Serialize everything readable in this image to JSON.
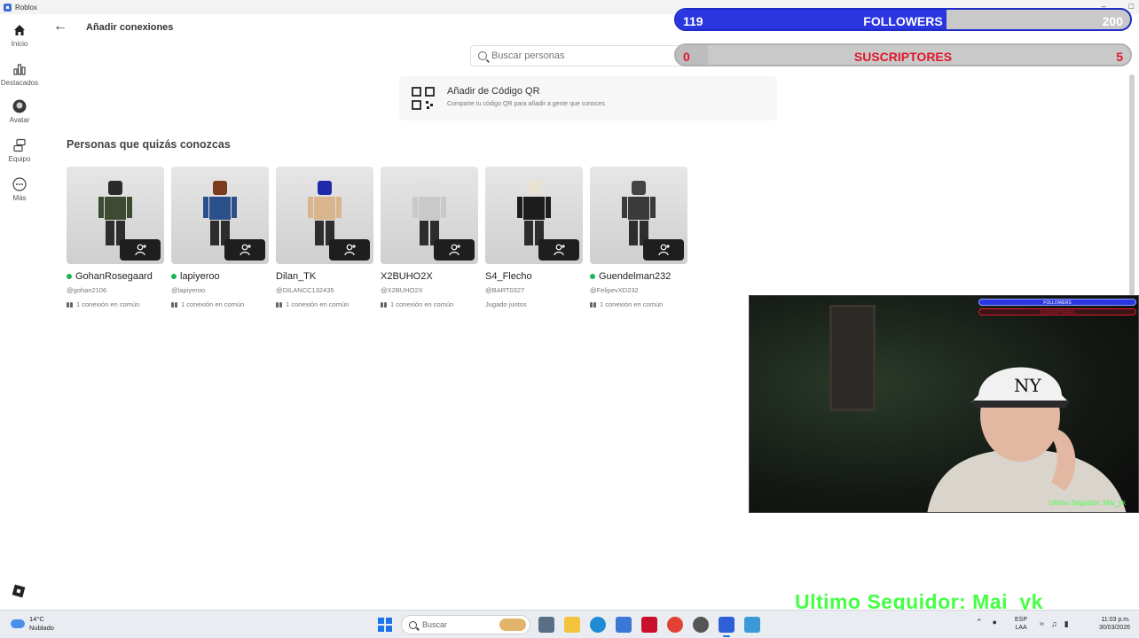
{
  "window": {
    "title": "Roblox"
  },
  "rail": {
    "items": [
      {
        "label": "Inicio"
      },
      {
        "label": "Destacados"
      },
      {
        "label": "Avatar"
      },
      {
        "label": "Equipo"
      },
      {
        "label": "Más"
      }
    ]
  },
  "header": {
    "title": "Añadir conexiones"
  },
  "search": {
    "placeholder": "Buscar personas"
  },
  "qr": {
    "title": "Añadir de Código QR",
    "subtitle": "Comparte tu código QR para añadir a gente que conoces"
  },
  "section": {
    "title": "Personas que quizás conozcas"
  },
  "people": [
    {
      "name": "GohanRosegaard",
      "handle": "@gohan2106",
      "meta": "1 conexión en común",
      "online": true,
      "shirt": "#3f4a33",
      "head": "#2b2b2b"
    },
    {
      "name": "lapiyeroo",
      "handle": "@lapiyeroo",
      "meta": "1 conexión en común",
      "online": true,
      "shirt": "#2b4f8a",
      "head": "#7a3b1e"
    },
    {
      "name": "Dilan_TK",
      "handle": "@DILANCC132435",
      "meta": "1 conexión en común",
      "online": false,
      "shirt": "#d9b58e",
      "head": "#1f2aa8"
    },
    {
      "name": "X2BUHO2X",
      "handle": "@X2BUHO2X",
      "meta": "1 conexión en común",
      "online": false,
      "shirt": "#c9c9c9",
      "head": "#e0e0e0"
    },
    {
      "name": "S4_Flecho",
      "handle": "@BART0327",
      "meta": "Jugado juntos",
      "online": false,
      "shirt": "#1c1c1c",
      "head": "#e8e2d2"
    },
    {
      "name": "Guendelman232",
      "handle": "@FelipevXD232",
      "meta": "1 conexión en común",
      "online": true,
      "shirt": "#3a3a3a",
      "head": "#444444"
    }
  ],
  "overlay": {
    "followers": {
      "current": "119",
      "label": "FOLLOWERS",
      "goal": "200",
      "progress": 0.595
    },
    "subscribers": {
      "current": "0",
      "label": "SUSCRIPTORES",
      "goal": "5",
      "progress": 0.0
    },
    "cam_caption": "Ultimo Seguidor: Mai_yk",
    "last_follower": "Ultimo Seguidor: Mai_yk"
  },
  "taskbar": {
    "weather_temp": "14°C",
    "weather_desc": "Nublado",
    "search_label": "Buscar",
    "lang_top": "ESP",
    "lang_bottom": "LAA",
    "time": "11:03 p.m.",
    "date": "30/03/2026"
  },
  "colors": {
    "followers_bar": "#2b36e0",
    "subs_text": "#e0182c",
    "online_dot": "#1bb35c",
    "follower_alert": "#44ff44"
  }
}
